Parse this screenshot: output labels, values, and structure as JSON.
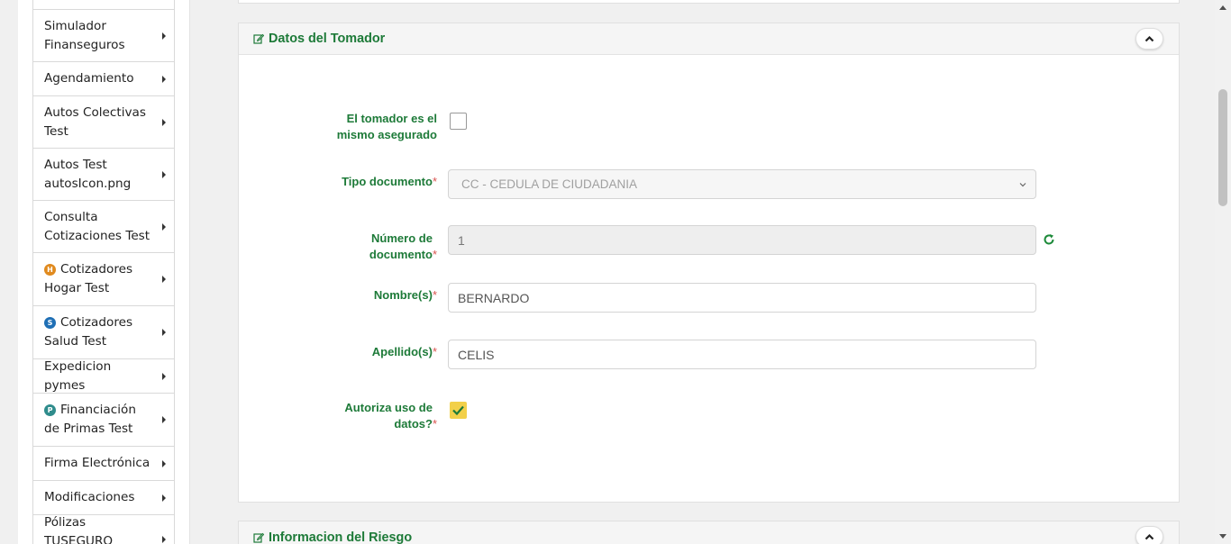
{
  "sidebar": {
    "items": [
      {
        "label": "Simulador Finanseguros",
        "badge": ""
      },
      {
        "label": "Agendamiento",
        "badge": ""
      },
      {
        "label": "Autos Colectivas Test",
        "badge": ""
      },
      {
        "label": "Autos Test autosIcon.png",
        "badge": ""
      },
      {
        "label": "Consulta Cotizaciones Test",
        "badge": ""
      },
      {
        "label": "Cotizadores Hogar Test",
        "badge": "H",
        "badge_color": "#e08a1e"
      },
      {
        "label": "Cotizadores Salud Test",
        "badge": "S",
        "badge_color": "#1f6fb5"
      },
      {
        "label": "Expedicion pymes",
        "badge": ""
      },
      {
        "label": "Financiación de Primas Test",
        "badge": "P",
        "badge_color": "#2f8c8c"
      },
      {
        "label": "Firma Electrónica",
        "badge": ""
      },
      {
        "label": "Modificaciones",
        "badge": ""
      },
      {
        "label": "Pólizas TUSEGURO",
        "badge": ""
      }
    ]
  },
  "panel": {
    "title": "Datos del Tomador",
    "fields": {
      "same_insured_label": "El tomador es el mismo asegurado",
      "same_insured_checked": false,
      "doc_type_label": "Tipo documento",
      "doc_type_value": "CC - CEDULA DE CIUDADANIA",
      "doc_number_label": "Número de documento",
      "doc_number_value": "1",
      "names_label": "Nombre(s)",
      "names_value": "BERNARDO",
      "surnames_label": "Apellido(s)",
      "surnames_value": "CELIS",
      "authorize_label": "Autoriza uso de datos?",
      "authorize_checked": true,
      "required_mark": "*"
    }
  },
  "next_panel": {
    "title": "Informacion del Riesgo"
  },
  "colors": {
    "accent_green": "#1d7a38",
    "required_red": "#d9534f",
    "checkbox_yellow": "#f2d04a"
  },
  "icons": {
    "edit": "edit-icon",
    "collapse": "chevron-up-icon",
    "refresh": "refresh-icon",
    "submenu": "caret-right-icon",
    "checkmark": "check-icon"
  }
}
